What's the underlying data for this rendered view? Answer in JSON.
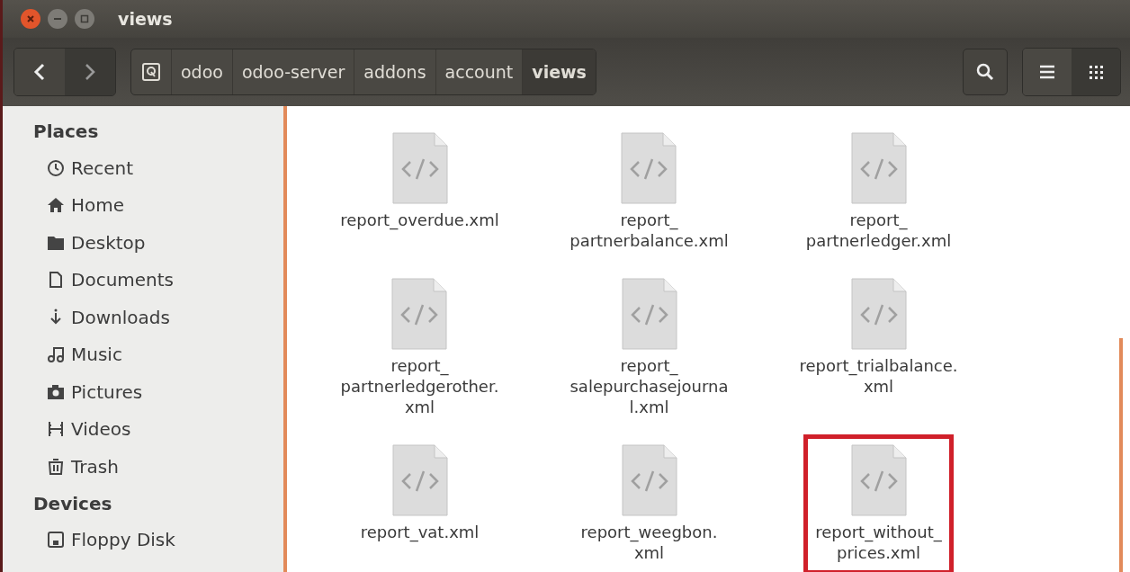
{
  "window": {
    "title": "views"
  },
  "toolbar": {
    "breadcrumbs": [
      {
        "label": "odoo",
        "selected": false
      },
      {
        "label": "odoo-server",
        "selected": false
      },
      {
        "label": "addons",
        "selected": false
      },
      {
        "label": "account",
        "selected": false
      },
      {
        "label": "views",
        "selected": true
      }
    ],
    "view_buttons": [
      {
        "kind": "list",
        "selected": false
      },
      {
        "kind": "grid",
        "selected": true
      }
    ]
  },
  "sidebar": {
    "sections": [
      {
        "title": "Places",
        "items": [
          {
            "label": "Recent",
            "kind": "recent"
          },
          {
            "label": "Home",
            "kind": "home"
          },
          {
            "label": "Desktop",
            "kind": "desktop"
          },
          {
            "label": "Documents",
            "kind": "documents"
          },
          {
            "label": "Downloads",
            "kind": "downloads"
          },
          {
            "label": "Music",
            "kind": "music"
          },
          {
            "label": "Pictures",
            "kind": "pictures"
          },
          {
            "label": "Videos",
            "kind": "videos"
          },
          {
            "label": "Trash",
            "kind": "trash"
          }
        ]
      },
      {
        "title": "Devices",
        "items": [
          {
            "label": "Floppy Disk",
            "kind": "floppy"
          }
        ]
      }
    ]
  },
  "files": [
    {
      "lines": [
        "report_overdue.xml"
      ],
      "highlighted": false
    },
    {
      "lines": [
        "report_",
        "partnerbalance.xml"
      ],
      "highlighted": false
    },
    {
      "lines": [
        "report_",
        "partnerledger.xml"
      ],
      "highlighted": false
    },
    {
      "lines": [
        "report_",
        "partnerledgerother.",
        "xml"
      ],
      "highlighted": false
    },
    {
      "lines": [
        "report_",
        "salepurchasejourna",
        "l.xml"
      ],
      "highlighted": false
    },
    {
      "lines": [
        "report_trialbalance.",
        "xml"
      ],
      "highlighted": false
    },
    {
      "lines": [
        "report_vat.xml"
      ],
      "highlighted": false
    },
    {
      "lines": [
        "report_weegbon.",
        "xml"
      ],
      "highlighted": false
    },
    {
      "lines": [
        "report_without_",
        "prices.xml"
      ],
      "highlighted": true
    }
  ]
}
